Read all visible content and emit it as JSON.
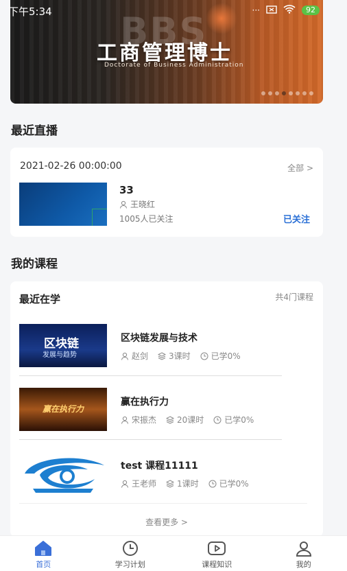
{
  "status_bar": {
    "time": "下午5:34",
    "battery": "92",
    "dots": "···"
  },
  "banner": {
    "watermark": "BBS",
    "title": "工商管理博士",
    "subtitle": "Doctorate of Business Administration",
    "slide_count": 8,
    "active_slide": 4
  },
  "live": {
    "section_title": "最近直播",
    "date": "2021-02-26 00:00:00",
    "all_link": "全部 >",
    "name": "33",
    "teacher": "王晓红",
    "followers": "1005人已关注",
    "follow_status": "已关注"
  },
  "courses": {
    "section_title": "我的课程",
    "header": "最近在学",
    "count": "共4门课程",
    "items": [
      {
        "name": "区块链发展与技术",
        "teacher": "赵剑",
        "lessons": "3课时",
        "progress": "已学0%",
        "img_title": "区块链",
        "img_sub": "发展与趋势"
      },
      {
        "name": "赢在执行力",
        "teacher": "宋振杰",
        "lessons": "20课时",
        "progress": "已学0%",
        "img_title": "赢在执行力"
      },
      {
        "name": "test 课程11111",
        "teacher": "王老师",
        "lessons": "1课时",
        "progress": "已学0%"
      }
    ],
    "more": "查看更多 >"
  },
  "tabs": [
    {
      "label": "首页",
      "icon": "home-icon",
      "active": true
    },
    {
      "label": "学习计划",
      "icon": "clock-icon",
      "active": false
    },
    {
      "label": "课程知识",
      "icon": "play-icon",
      "active": false
    },
    {
      "label": "我的",
      "icon": "user-icon",
      "active": false
    }
  ],
  "colors": {
    "accent": "#3a6fd8",
    "follow": "#2a6fd6"
  }
}
